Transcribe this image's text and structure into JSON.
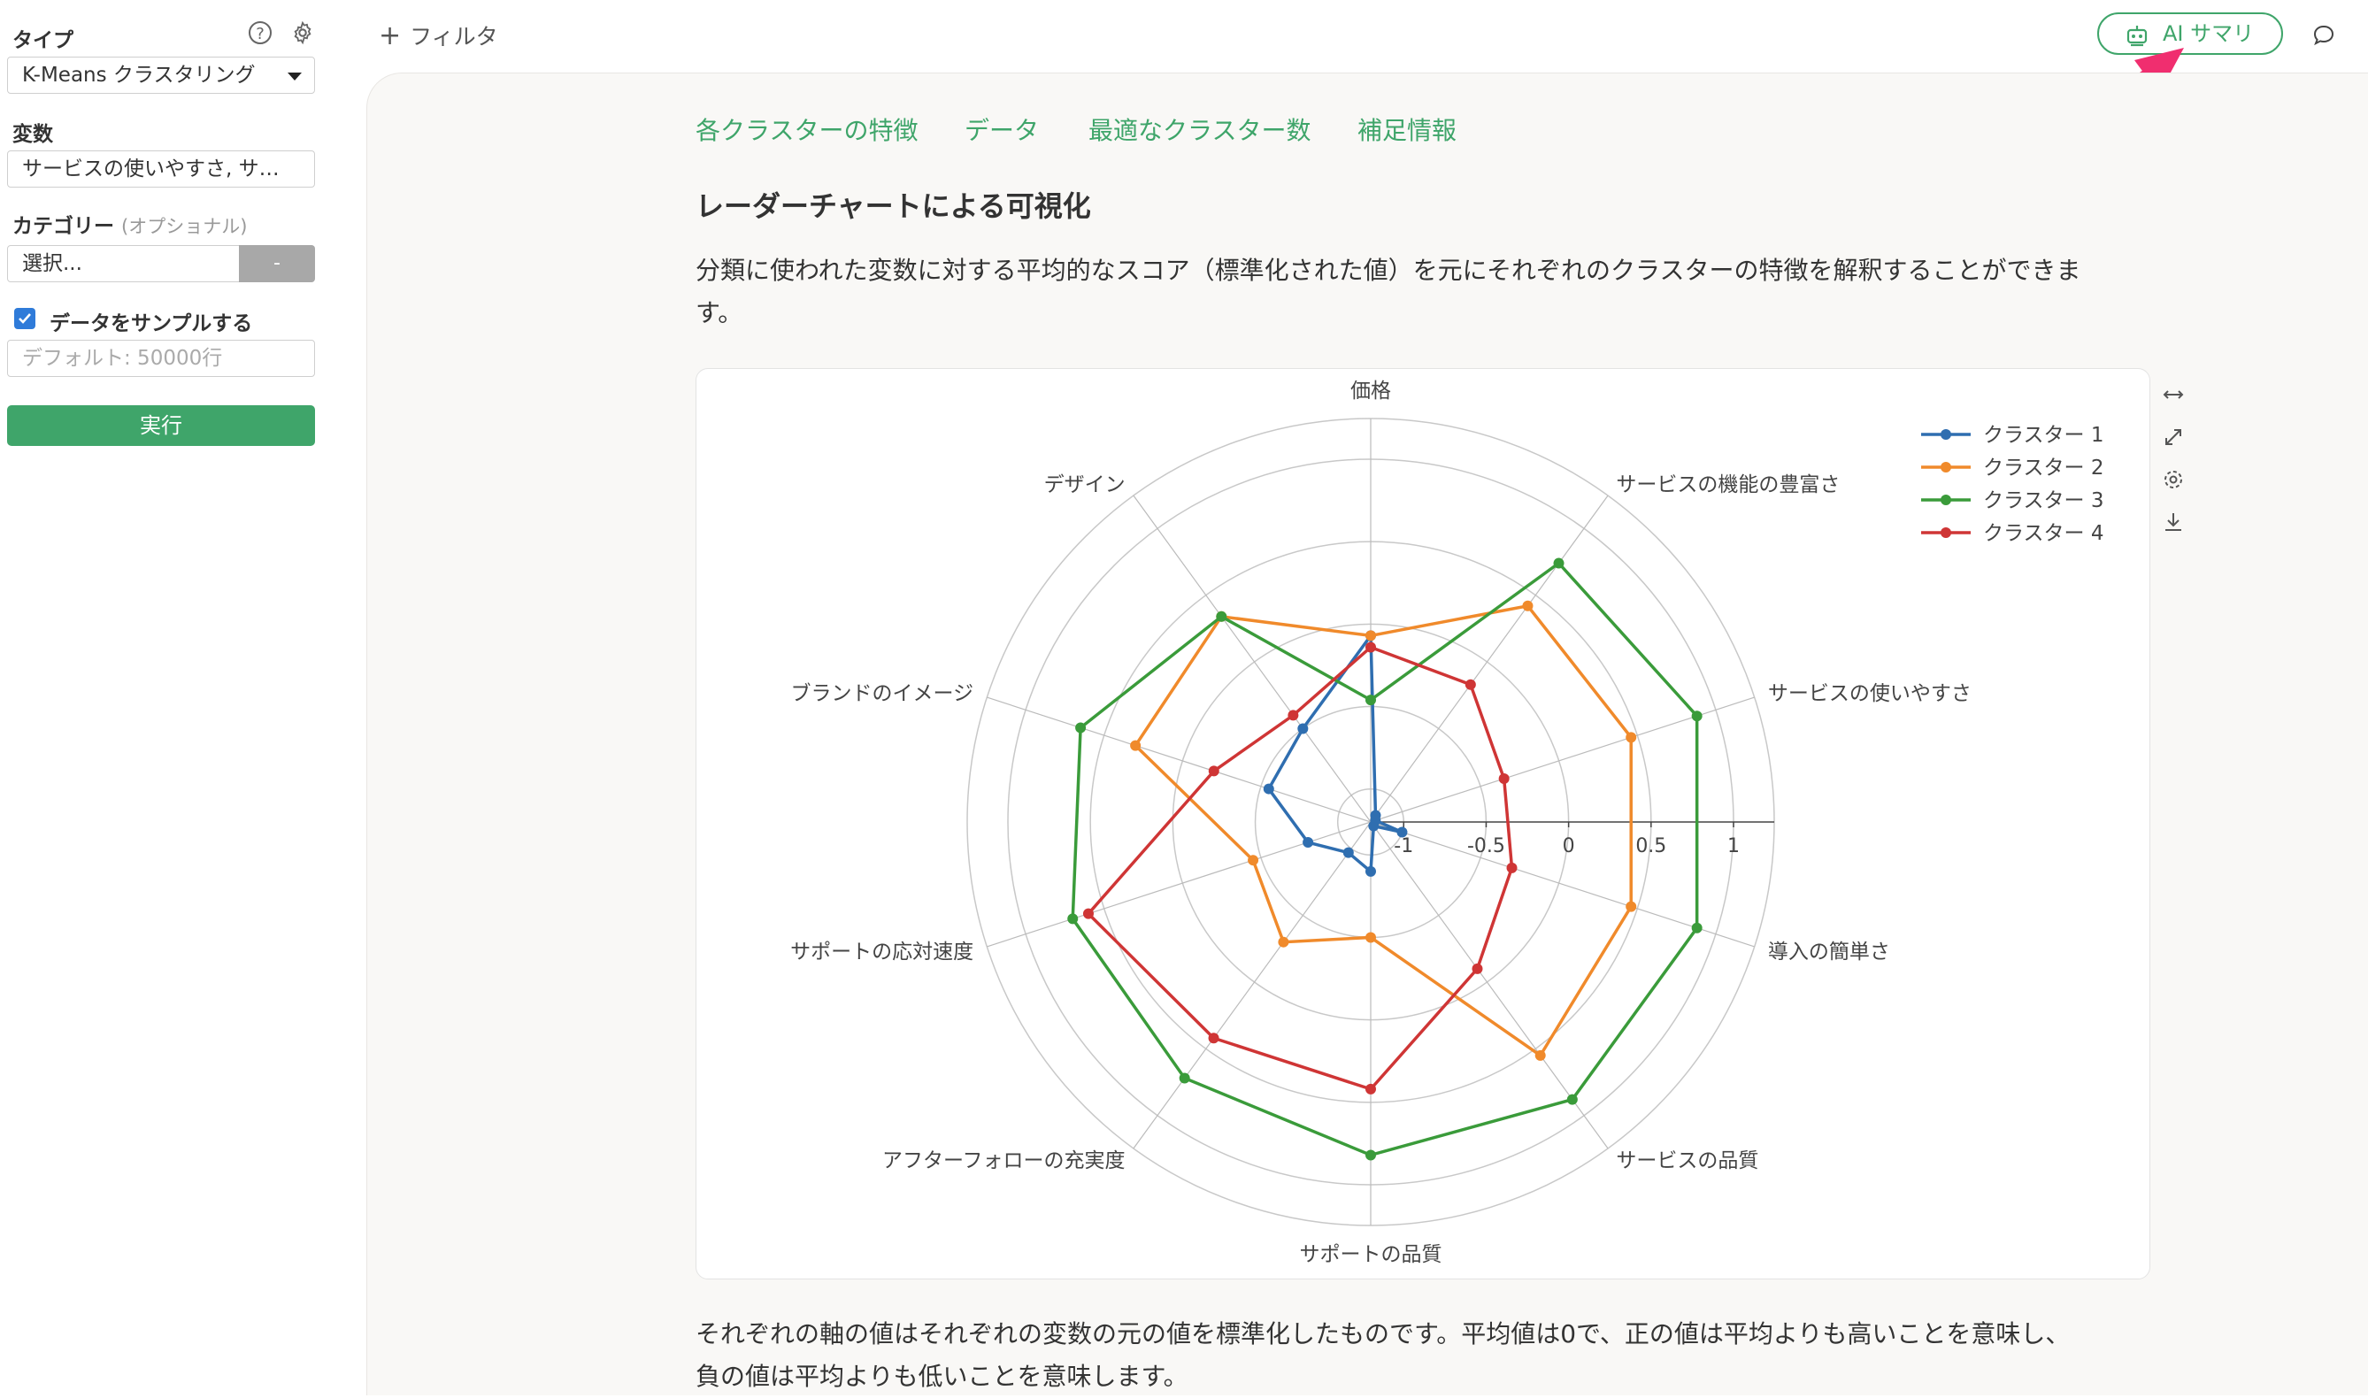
{
  "sidebar": {
    "type_label": "タイプ",
    "type_value": "K-Means クラスタリング",
    "variables_label": "変数",
    "variables_value": "サービスの使いやすさ, サ…",
    "category_label": "カテゴリー",
    "category_optional": "(オプショナル)",
    "category_placeholder": "選択...",
    "category_button": "-",
    "sample_label": "データをサンプルする",
    "sample_placeholder": "デフォルト: 50000行",
    "run_label": "実行"
  },
  "topbar": {
    "filter_label": "フィルタ",
    "ai_label": "AI サマリ"
  },
  "main": {
    "tabs": [
      "各クラスターの特徴",
      "データ",
      "最適なクラスター数",
      "補足情報"
    ],
    "heading": "レーダーチャートによる可視化",
    "intro_line1": "分類に使われた変数に対する平均的なスコア（標準化された値）を元にそれぞれのクラスターの特徴を解釈することができま",
    "intro_line2": "す。",
    "footer_line1": "それぞれの軸の値はそれぞれの変数の元の値を標準化したものです。平均値は0で、正の値は平均よりも高いことを意味し、",
    "footer_line2": "負の値は平均よりも低いことを意味します。"
  },
  "chart_data": {
    "type": "radar",
    "axes": [
      "価格",
      "サービスの機能の豊富さ",
      "サービスの使いやすさ",
      "導入の簡単さ",
      "サービスの品質",
      "サポートの品質",
      "アフターフォローの充実度",
      "サポートの応対速度",
      "ブランドのイメージ",
      "デザイン"
    ],
    "radial_ticks": [
      "-1",
      "-0.5",
      "0",
      "0.5",
      "1"
    ],
    "range": [
      -1.2,
      1.0
    ],
    "legend_position": "top-right",
    "series": [
      {
        "name": "クラスター 1",
        "color": "#2f6eb0",
        "values": [
          -0.07,
          -1.15,
          -1.17,
          -1.0,
          -1.17,
          -0.9,
          -0.97,
          -0.8,
          -0.55,
          -0.5
        ]
      },
      {
        "name": "クラスター 2",
        "color": "#f08a2b",
        "values": [
          -0.07,
          0.42,
          0.46,
          0.46,
          0.55,
          -0.5,
          -0.3,
          -0.45,
          0.3,
          0.34
        ]
      },
      {
        "name": "クラスター 3",
        "color": "#3a9b3a",
        "values": [
          -0.46,
          0.74,
          0.88,
          0.88,
          0.88,
          0.82,
          0.72,
          0.7,
          0.65,
          0.34
        ]
      },
      {
        "name": "クラスター 4",
        "color": "#cf3535",
        "values": [
          -0.14,
          -0.17,
          -0.35,
          -0.3,
          -0.1,
          0.42,
          0.42,
          0.6,
          -0.2,
          -0.4
        ]
      }
    ]
  }
}
